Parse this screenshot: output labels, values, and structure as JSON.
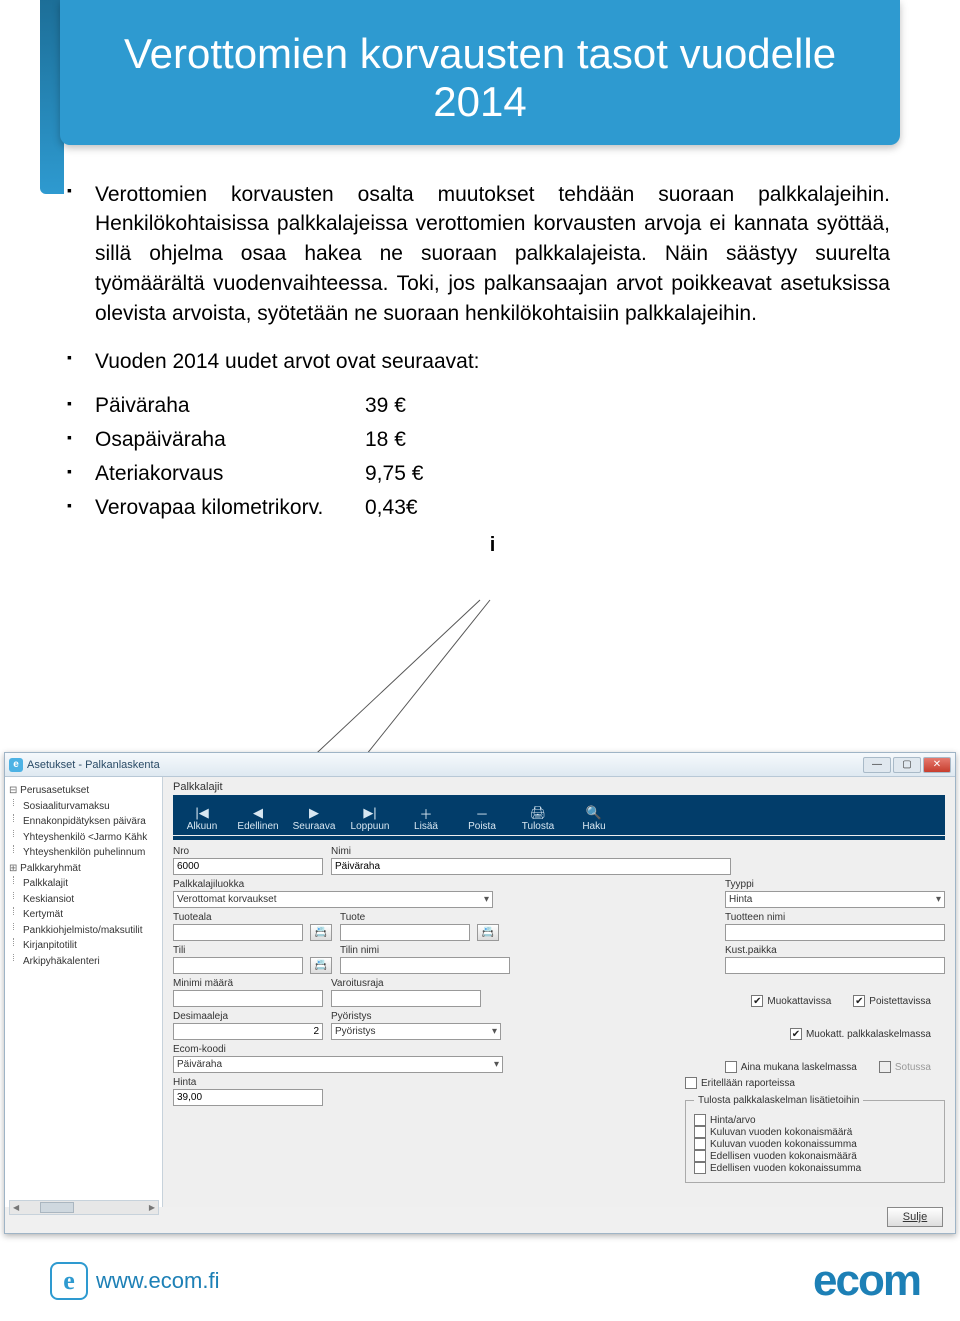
{
  "banner": {
    "title": "Verottomien korvausten tasot vuodelle 2014"
  },
  "bullets": {
    "p1": "Verottomien korvausten osalta muutokset tehdään suoraan palkkalajeihin. Henkilökohtaisissa palkkalajeissa verottomien korvausten arvoja ei kannata syöttää, sillä ohjelma osaa hakea ne suoraan palkkalajeista. Näin säästyy suurelta työmäärältä vuodenvaihteessa. Toki, jos palkansaajan arvot poikkeavat asetuksissa olevista arvoista, syötetään ne suoraan henkilökohtaisiin palkkalajeihin.",
    "p2": "Vuoden 2014 uudet arvot ovat seuraavat:"
  },
  "values": [
    {
      "label": "Päiväraha",
      "amount": "39 €"
    },
    {
      "label": "Osapäiväraha",
      "amount": "18 €"
    },
    {
      "label": "Ateriakorvaus",
      "amount": "9,75 €"
    },
    {
      "label": "Verovapaa kilometrikorv.",
      "amount": "0,43€"
    }
  ],
  "callout": "i",
  "window": {
    "title": "Asetukset - Palkanlaskenta",
    "tree": {
      "root": "Perusasetukset",
      "children": [
        "Sosiaaliturvamaksu",
        "Ennakonpidätyksen päivära",
        "Yhteyshenkilö <Jarmo Kähk",
        "Yhteyshenkilön puhelinnum"
      ],
      "group": "Palkkaryhmät",
      "items": [
        "Palkkalajit",
        "Keskiansiot",
        "Kertymät",
        "Pankkiohjelmisto/maksutilit",
        "Kirjanpitotilit",
        "Arkipyhäkalenteri"
      ]
    },
    "mainTitle": "Palkkalajit",
    "toolbar": [
      {
        "icon": "|◀",
        "label": "Alkuun"
      },
      {
        "icon": "◀",
        "label": "Edellinen"
      },
      {
        "icon": "▶",
        "label": "Seuraava"
      },
      {
        "icon": "▶|",
        "label": "Loppuun"
      },
      {
        "icon": "＋",
        "label": "Lisää"
      },
      {
        "icon": "－",
        "label": "Poista"
      },
      {
        "icon": "🖨",
        "label": "Tulosta"
      },
      {
        "icon": "🔍",
        "label": "Haku"
      }
    ],
    "fields": {
      "nro": {
        "label": "Nro",
        "value": "6000"
      },
      "nimi": {
        "label": "Nimi",
        "value": "Päiväraha"
      },
      "luokka": {
        "label": "Palkkalajiluokka",
        "value": "Verottomat korvaukset"
      },
      "tyyppi": {
        "label": "Tyyppi",
        "value": "Hinta"
      },
      "tuoteala": {
        "label": "Tuoteala"
      },
      "tuote": {
        "label": "Tuote"
      },
      "tuotenimi": {
        "label": "Tuotteen nimi"
      },
      "tili": {
        "label": "Tili"
      },
      "tilinimi": {
        "label": "Tilin nimi"
      },
      "kust": {
        "label": "Kust.paikka"
      },
      "min": {
        "label": "Minimi määrä"
      },
      "varo": {
        "label": "Varoitusraja"
      },
      "desim": {
        "label": "Desimaaleja",
        "value": "2"
      },
      "pyor": {
        "label": "Pyöristys",
        "value": "Pyöristys"
      },
      "ecom": {
        "label": "Ecom-koodi",
        "value": "Päiväraha"
      },
      "hinta": {
        "label": "Hinta",
        "value": "39,00"
      }
    },
    "checks": {
      "muokattavissa": "Muokattavissa",
      "poistettavissa": "Poistettavissa",
      "muokattLask": "Muokatt. palkkalaskelmassa",
      "ainaMukana": "Aina mukana laskelmassa",
      "sotussa": "Sotussa",
      "eritellaan": "Eritellään raporteissa"
    },
    "printGroup": {
      "legend": "Tulosta palkkalaskelman lisätietoihin",
      "opts": [
        "Hinta/arvo",
        "Kuluvan vuoden kokonaismäärä",
        "Kuluvan vuoden kokonaissumma",
        "Edellisen vuoden kokonaismäärä",
        "Edellisen vuoden kokonaissumma"
      ]
    },
    "close": "Sulje"
  },
  "footer": {
    "url": "www.ecom.fi",
    "brand": "ecom"
  }
}
